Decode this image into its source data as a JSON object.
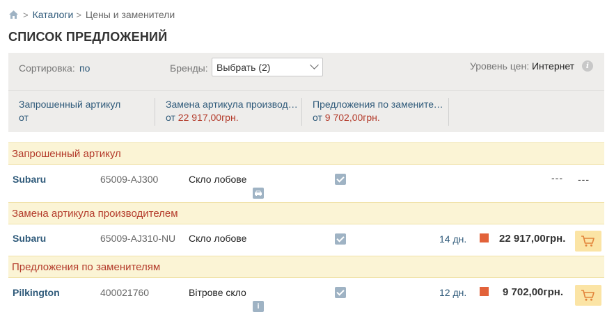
{
  "breadcrumb": {
    "home_icon": "home-icon",
    "link": "Каталоги",
    "current": "Цены и заменители"
  },
  "page_title": "СПИСОК ПРЕДЛОЖЕНИЙ",
  "filters": {
    "sort_label": "Сортировка:",
    "sort_value": "по",
    "brands_label": "Бренды:",
    "brands_value": "Выбрать (2)",
    "price_level_label": "Уровень цен:",
    "price_level_value": "Интернет",
    "info_glyph": "i"
  },
  "summary": [
    {
      "title": "Запрошенный артикул",
      "prefix": "от",
      "amount": ""
    },
    {
      "title": "Замена артикула производителем",
      "prefix": "от",
      "amount": "22 917,00грн."
    },
    {
      "title": "Предложения по заменителям",
      "prefix": "от",
      "amount": "9 702,00грн."
    }
  ],
  "sections": [
    {
      "title": "Запрошенный артикул"
    },
    {
      "title": "Замена артикула производителем"
    },
    {
      "title": "Предложения по заменителям"
    }
  ],
  "rows": [
    {
      "brand": "Subaru",
      "article": "65009-AJ300",
      "description": "Скло лобове",
      "sub_icon": "car-icon",
      "days": "",
      "price": "---",
      "extra": "---"
    },
    {
      "brand": "Subaru",
      "article": "65009-AJ310-NU",
      "description": "Скло лобове",
      "days": "14 дн.",
      "price": "22 917,00грн.",
      "status_color": "#e2623a"
    },
    {
      "brand": "Pilkington",
      "article": "400021760",
      "description": "Вітрове скло",
      "sub_icon": "info-icon",
      "days": "12 дн.",
      "price": "9 702,00грн.",
      "status_color": "#e2623a"
    }
  ],
  "colors": {
    "accent_blue": "#2f5a7a",
    "accent_red": "#b33a2a",
    "section_bg": "#fbf4d5",
    "cart_bg": "#fbe4a5",
    "status_orange": "#e2623a"
  },
  "icons": {
    "cart": "cart-icon",
    "checkbox": "checkbox-checked-icon",
    "info_small": "i"
  }
}
